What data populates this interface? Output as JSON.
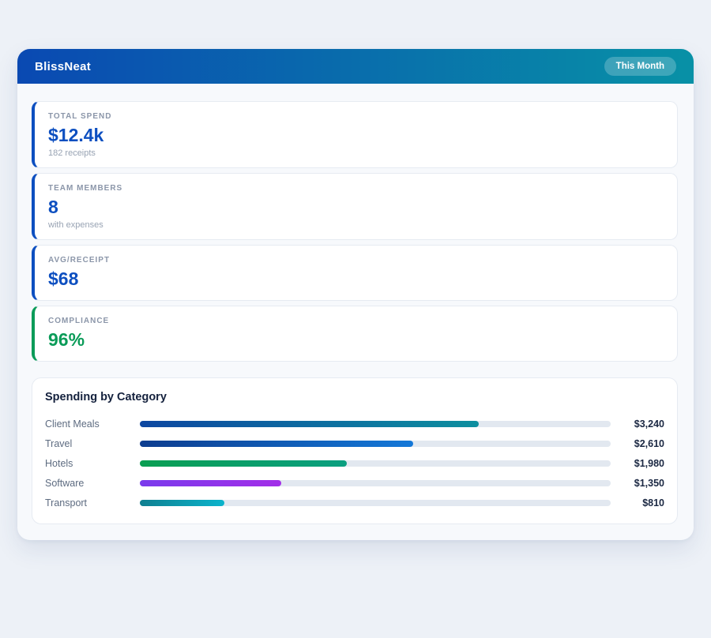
{
  "page": {
    "background": "#edf1f7",
    "panel_background": "#f7f9fc"
  },
  "header": {
    "title": "BlissNeat",
    "badge_label": "This Month",
    "gradient_from": "#0a49b2",
    "gradient_to": "#0891a6",
    "text_color": "#ffffff"
  },
  "stats": [
    {
      "label": "TOTAL SPEND",
      "value": "$12.4k",
      "sub": "182 receipts",
      "accent": "#0d4fc0"
    },
    {
      "label": "TEAM MEMBERS",
      "value": "8",
      "sub": "with expenses",
      "accent": "#0d4fc0"
    },
    {
      "label": "AVG/RECEIPT",
      "value": "$68",
      "sub": "",
      "accent": "#0d4fc0"
    },
    {
      "label": "COMPLIANCE",
      "value": "96%",
      "sub": "",
      "accent": "#0a9b58"
    }
  ],
  "chart": {
    "title": "Spending by Category",
    "track_color": "#e2e8f0",
    "rows": [
      {
        "label": "Client Meals",
        "value_label": "$3,240",
        "amount": 3240,
        "percent": 72,
        "color_from": "#0d47a1",
        "color_to": "#0d8f9f"
      },
      {
        "label": "Travel",
        "value_label": "$2,610",
        "amount": 2610,
        "percent": 58,
        "color_from": "#0d3d8f",
        "color_to": "#1478d8"
      },
      {
        "label": "Hotels",
        "value_label": "$1,980",
        "amount": 1980,
        "percent": 44,
        "color_from": "#0b9e52",
        "color_to": "#0b9f80"
      },
      {
        "label": "Software",
        "value_label": "$1,350",
        "amount": 1350,
        "percent": 30,
        "color_from": "#7a3bec",
        "color_to": "#a22ee8"
      },
      {
        "label": "Transport",
        "value_label": "$810",
        "amount": 810,
        "percent": 18,
        "color_from": "#0f7f90",
        "color_to": "#0cb4cc"
      }
    ]
  },
  "chart_data": {
    "type": "bar",
    "orientation": "horizontal",
    "title": "Spending by Category",
    "categories": [
      "Client Meals",
      "Travel",
      "Hotels",
      "Software",
      "Transport"
    ],
    "values": [
      3240,
      2610,
      1980,
      1350,
      810
    ],
    "value_labels": [
      "$3,240",
      "$2,610",
      "$1,980",
      "$1,350",
      "$810"
    ],
    "xlabel": "",
    "ylabel": "",
    "xlim": [
      0,
      4500
    ],
    "grid": false,
    "legend": false
  }
}
